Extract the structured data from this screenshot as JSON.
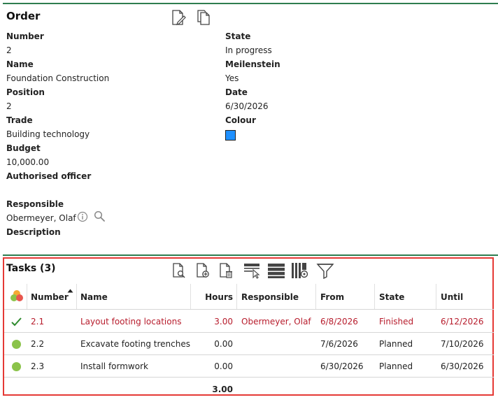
{
  "order": {
    "title": "Order",
    "fields": {
      "number": {
        "label": "Number",
        "value": "2"
      },
      "name": {
        "label": "Name",
        "value": "Foundation Construction"
      },
      "position": {
        "label": "Position",
        "value": "2"
      },
      "trade": {
        "label": "Trade",
        "value": "Building technology"
      },
      "budget": {
        "label": "Budget",
        "value": "10,000.00"
      },
      "authorised_officer": {
        "label": "Authorised officer",
        "value": ""
      },
      "responsible": {
        "label": "Responsible",
        "value": "Obermeyer, Olaf"
      },
      "description": {
        "label": "Description",
        "value": ""
      },
      "state": {
        "label": "State",
        "value": "In progress"
      },
      "milestone": {
        "label": "Meilenstein",
        "value": "Yes"
      },
      "date": {
        "label": "Date",
        "value": "6/30/2026"
      },
      "colour": {
        "label": "Colour",
        "value": "#1e90ff"
      }
    }
  },
  "tasks": {
    "title": "Tasks (3)",
    "columns": {
      "number": "Number",
      "name": "Name",
      "hours": "Hours",
      "responsible": "Responsible",
      "from": "From",
      "state": "State",
      "until": "Until"
    },
    "rows": [
      {
        "status_icon": "checkmark-icon",
        "number": "2.1",
        "name": "Layout footing locations",
        "hours": "3.00",
        "responsible": "Obermeyer, Olaf",
        "from": "6/8/2026",
        "state": "Finished",
        "until": "6/12/2026"
      },
      {
        "status_icon": "green-dot-icon",
        "number": "2.2",
        "name": "Excavate footing trenches",
        "hours": "0.00",
        "responsible": "",
        "from": "7/6/2026",
        "state": "Planned",
        "until": "7/10/2026"
      },
      {
        "status_icon": "green-dot-icon",
        "number": "2.3",
        "name": "Install formwork",
        "hours": "0.00",
        "responsible": "",
        "from": "6/30/2026",
        "state": "Planned",
        "until": "6/30/2026"
      }
    ],
    "total_hours": "3.00"
  },
  "colors": {
    "accent_line": "#2e7d4f",
    "selection_border": "#e53935",
    "finished_text": "#b71c2c",
    "planned_dot": "#8bc34a"
  }
}
